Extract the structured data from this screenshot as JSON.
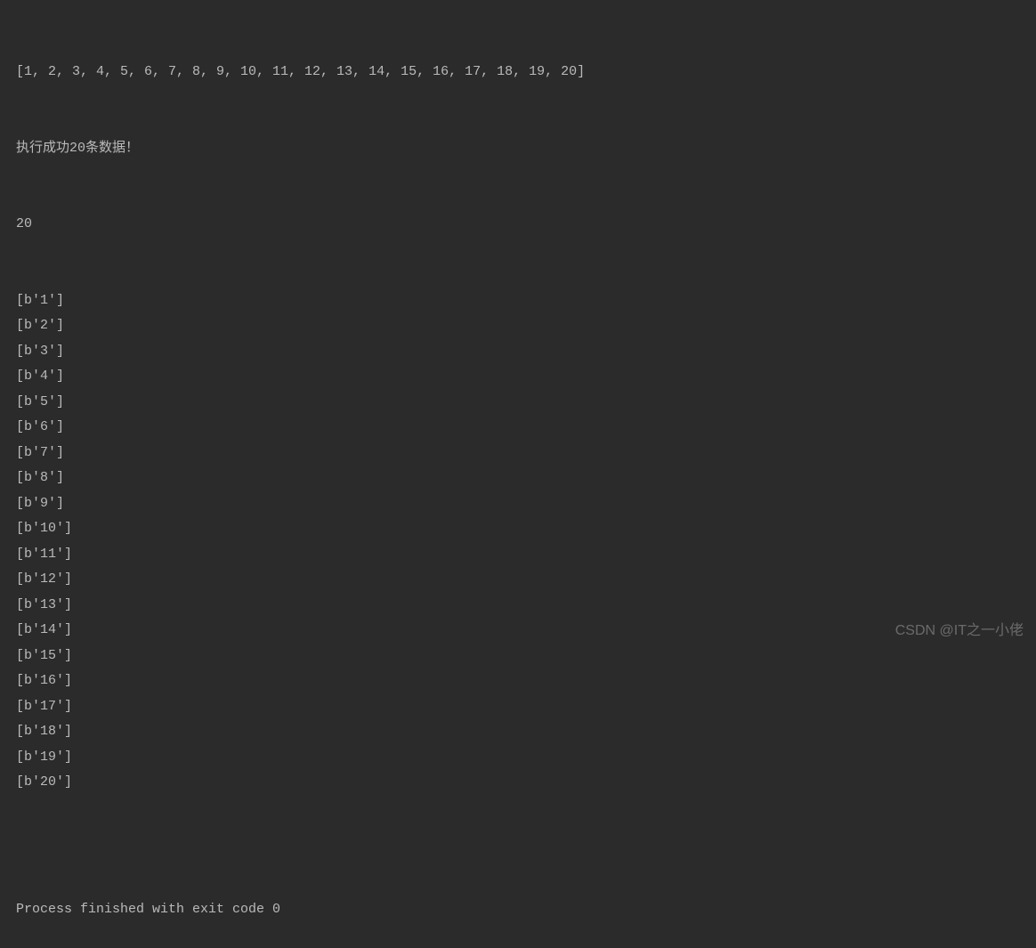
{
  "console": {
    "list_output": "[1, 2, 3, 4, 5, 6, 7, 8, 9, 10, 11, 12, 13, 14, 15, 16, 17, 18, 19, 20]",
    "success_message": "执行成功20条数据！",
    "count": "20",
    "byte_lines": [
      "[b'1']",
      "[b'2']",
      "[b'3']",
      "[b'4']",
      "[b'5']",
      "[b'6']",
      "[b'7']",
      "[b'8']",
      "[b'9']",
      "[b'10']",
      "[b'11']",
      "[b'12']",
      "[b'13']",
      "[b'14']",
      "[b'15']",
      "[b'16']",
      "[b'17']",
      "[b'18']",
      "[b'19']",
      "[b'20']"
    ],
    "blank_line": "",
    "exit_message": "Process finished with exit code 0"
  },
  "watermark": "CSDN @IT之一小佬"
}
